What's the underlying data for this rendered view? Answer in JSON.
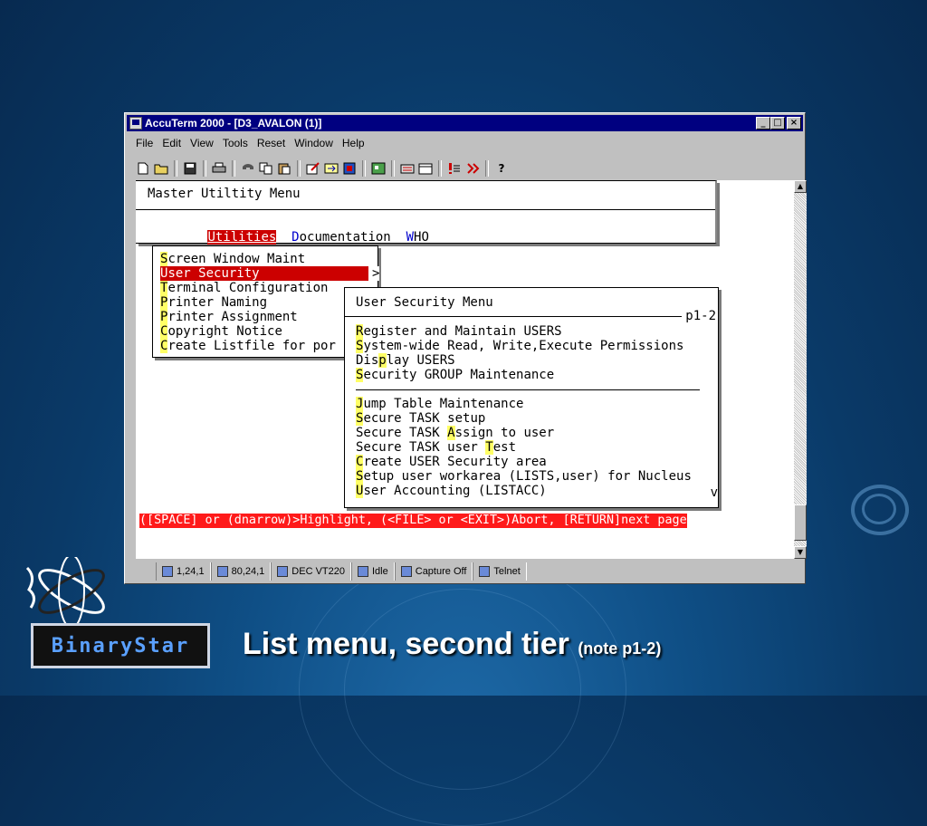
{
  "window": {
    "title": "AccuTerm 2000 - [D3_AVALON (1)]",
    "buttons": {
      "minimize": "_",
      "maximize": "□",
      "close": "×"
    }
  },
  "menubar": [
    "File",
    "Edit",
    "View",
    "Tools",
    "Reset",
    "Window",
    "Help"
  ],
  "toolbar_icons": [
    "new-icon",
    "open-icon",
    "save-icon",
    "print-icon",
    "phone-icon",
    "copy-icon",
    "paste-icon",
    "edit-icon",
    "transfer-icon",
    "capture-icon",
    "macro-icon",
    "keyboard-icon",
    "calendar-icon",
    "alert-icon",
    "settings-icon",
    "help-icon"
  ],
  "terminal": {
    "master_title": "Master Utiltity Menu",
    "top_menu": [
      "Utilities",
      "Documentation",
      "WHO"
    ],
    "utilities_items": [
      {
        "hot": "S",
        "rest": "creen Window Maint"
      },
      {
        "hot": "U",
        "rest": "ser Security",
        "selected": true,
        "arrow": ">"
      },
      {
        "hot": "T",
        "rest": "erminal Configuration"
      },
      {
        "hot": "P",
        "rest": "rinter Naming"
      },
      {
        "hot": "P",
        "rest": "rinter Assignment"
      },
      {
        "hot": "C",
        "rest": "opyright Notice"
      },
      {
        "hot": "C",
        "rest": "reate Listfile for por"
      }
    ],
    "security_title": "User Security Menu",
    "page_marker": "p1-2",
    "security_items_a": [
      {
        "pre": "",
        "hot": "R",
        "rest": "egister and Maintain USERS"
      },
      {
        "pre": "",
        "hot": "S",
        "rest": "ystem-wide Read, Write,Execute Permissions"
      },
      {
        "pre": "Dis",
        "hot": "p",
        "rest": "lay USERS"
      },
      {
        "pre": "",
        "hot": "S",
        "rest": "ecurity GROUP Maintenance"
      }
    ],
    "security_items_b": [
      {
        "pre": "",
        "hot": "J",
        "rest": "ump Table Maintenance"
      },
      {
        "pre": "",
        "hot": "S",
        "rest": "ecure TASK setup"
      },
      {
        "pre": "Secure TASK ",
        "hot": "A",
        "rest": "ssign to user"
      },
      {
        "pre": "Secure TASK user ",
        "hot": "T",
        "rest": "est"
      },
      {
        "pre": "",
        "hot": "C",
        "rest": "reate USER Security area"
      },
      {
        "pre": "",
        "hot": "S",
        "rest": "etup user workarea (LISTS,user) for Nucleus"
      },
      {
        "pre": "",
        "hot": "U",
        "rest": "ser Accounting (LISTACC)"
      }
    ],
    "more_marker": "v",
    "hint_line": "([SPACE] or (dnarrow)>Highlight, (<FILE> or <EXIT>)Abort, [RETURN]next page"
  },
  "statusbar": [
    {
      "icon": "cursor-position-icon",
      "label": "1,24,1"
    },
    {
      "icon": "screen-size-icon",
      "label": "80,24,1"
    },
    {
      "icon": "terminal-type-icon",
      "label": "DEC VT220"
    },
    {
      "icon": "printer-icon",
      "label": "Idle"
    },
    {
      "icon": "capture-icon",
      "label": "Capture Off"
    },
    {
      "icon": "telnet-icon",
      "label": "Telnet"
    }
  ],
  "caption": {
    "main": "List menu, second tier",
    "note": "(note p1-2)"
  },
  "logo": {
    "text": "BinaryStar"
  },
  "colors": {
    "titlebar": "#000080",
    "selection": "#cc0000",
    "hotkey": "#ffff66",
    "hint_bg": "#ff1a1a",
    "menu_blue": "#0000cc"
  }
}
